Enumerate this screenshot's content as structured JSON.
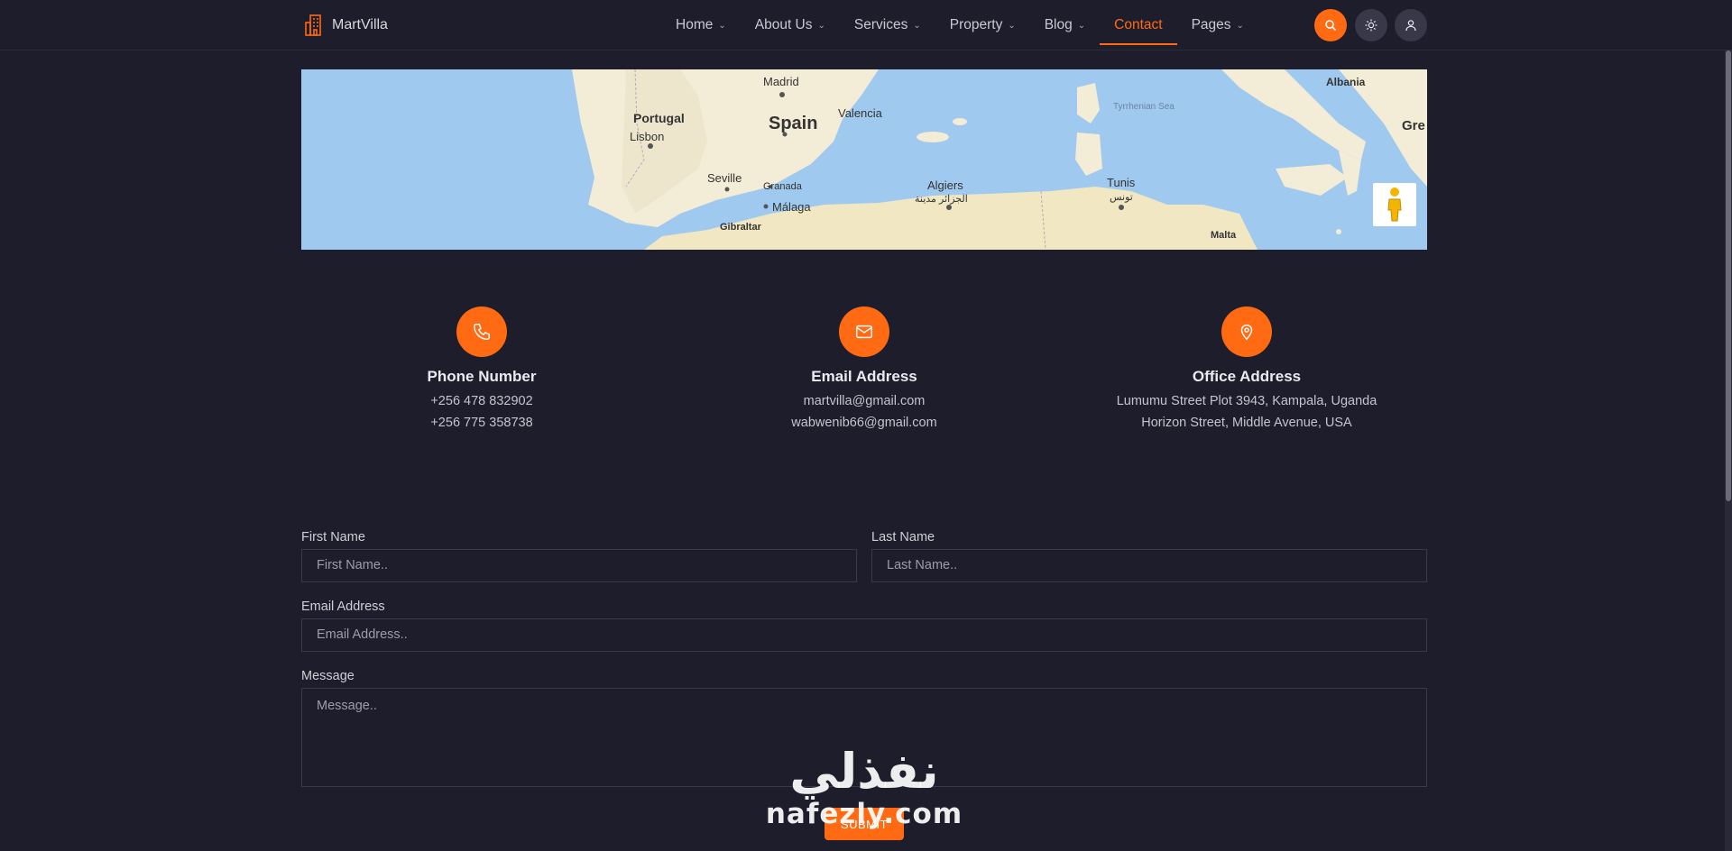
{
  "brand": {
    "name": "MartVilla",
    "icon": "building-icon"
  },
  "nav": [
    {
      "label": "Home",
      "chevron": true
    },
    {
      "label": "About Us",
      "chevron": true
    },
    {
      "label": "Services",
      "chevron": true
    },
    {
      "label": "Property",
      "chevron": true
    },
    {
      "label": "Blog",
      "chevron": true
    },
    {
      "label": "Contact",
      "chevron": false,
      "active": true
    },
    {
      "label": "Pages",
      "chevron": true
    }
  ],
  "header_buttons": [
    "search-icon",
    "sun-icon",
    "user-icon"
  ],
  "map": {
    "labels": [
      "Madrid",
      "Portugal",
      "Lisbon",
      "Spain",
      "Valencia",
      "Seville",
      "Granada",
      "Málaga",
      "Gibraltar",
      "Algiers",
      "الجزائر مدينة",
      "Tunis",
      "تونس",
      "Tyrrhenian Sea",
      "Albania",
      "Gre",
      "Malta"
    ]
  },
  "contact": [
    {
      "icon": "phone-icon",
      "title": "Phone Number",
      "lines": [
        "+256 478 832902",
        "+256 775 358738"
      ]
    },
    {
      "icon": "mail-icon",
      "title": "Email Address",
      "lines": [
        "martvilla@gmail.com",
        "wabwenib66@gmail.com"
      ]
    },
    {
      "icon": "location-pin-icon",
      "title": "Office Address",
      "lines": [
        "Lumumu Street Plot 3943, Kampala, Uganda",
        "Horizon Street, Middle Avenue, USA"
      ]
    }
  ],
  "form": {
    "first_name": {
      "label": "First Name",
      "placeholder": "First Name.."
    },
    "last_name": {
      "label": "Last Name",
      "placeholder": "Last Name.."
    },
    "email": {
      "label": "Email Address",
      "placeholder": "Email Address.."
    },
    "message": {
      "label": "Message",
      "placeholder": "Message.."
    },
    "submit": "SUBMIT"
  },
  "watermark": {
    "arabic": "نفذلي",
    "latin": "nafezly.com"
  },
  "colors": {
    "accent": "#ff6a13",
    "background": "#1e1d2b",
    "field_border": "#3a394a"
  }
}
